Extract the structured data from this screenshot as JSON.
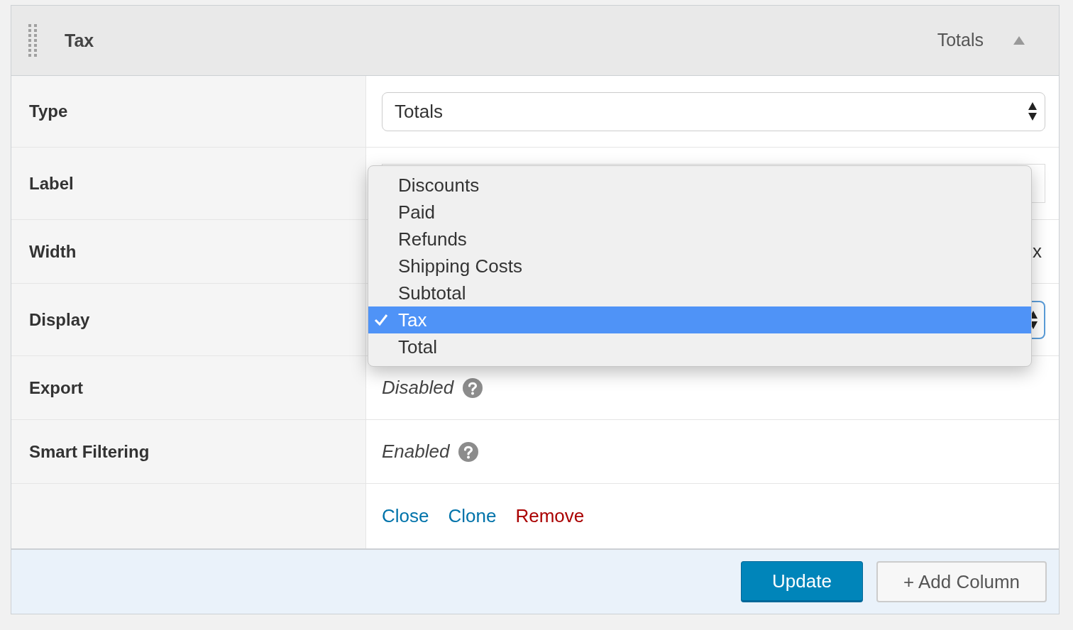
{
  "panel": {
    "title": "Tax",
    "type_label": "Totals",
    "expanded": true
  },
  "rows": [
    {
      "label": "Type",
      "kind": "select",
      "value": "Totals"
    },
    {
      "label": "Label",
      "kind": "input"
    },
    {
      "label": "Width",
      "kind": "unit",
      "unit": "x"
    },
    {
      "label": "Display",
      "kind": "select_focused"
    },
    {
      "label": "Export",
      "kind": "status",
      "value": "Disabled"
    },
    {
      "label": "Smart Filtering",
      "kind": "status",
      "value": "Enabled"
    },
    {
      "kind": "actions",
      "actions": [
        {
          "label": "Close",
          "kind": "link"
        },
        {
          "label": "Clone",
          "kind": "link"
        },
        {
          "label": "Remove",
          "kind": "danger"
        }
      ]
    }
  ],
  "dropdown": {
    "options": [
      {
        "label": "Discounts",
        "selected": false
      },
      {
        "label": "Paid",
        "selected": false
      },
      {
        "label": "Refunds",
        "selected": false
      },
      {
        "label": "Shipping Costs",
        "selected": false
      },
      {
        "label": "Subtotal",
        "selected": false
      },
      {
        "label": "Tax",
        "selected": true
      },
      {
        "label": "Total",
        "selected": false
      }
    ]
  },
  "footer": {
    "buttons": [
      {
        "label": "Update",
        "kind": "primary"
      },
      {
        "label": "+ Add Column",
        "kind": "secondary"
      }
    ]
  }
}
